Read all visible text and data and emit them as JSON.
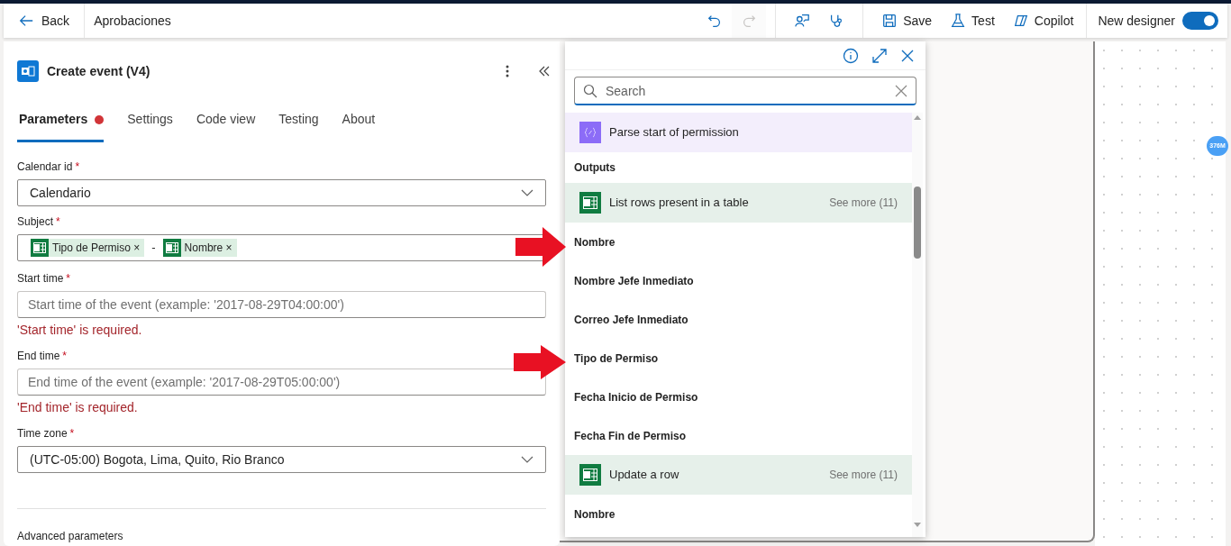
{
  "topbar": {
    "back": "Back",
    "flow_name": "Aprobaciones",
    "actions": [
      {
        "kind": "undo",
        "disabled": false
      },
      {
        "kind": "redo",
        "disabled": true
      },
      {
        "kind": "agent",
        "disabled": false
      },
      {
        "kind": "checker",
        "disabled": false
      },
      {
        "kind": "save",
        "label": "Save",
        "disabled": false
      },
      {
        "kind": "test",
        "label": "Test",
        "disabled": false
      },
      {
        "kind": "copilot",
        "label": "Copilot",
        "disabled": false
      }
    ],
    "toggle": {
      "label": "New designer",
      "on": true
    }
  },
  "panel": {
    "title": "Create event (V4)",
    "tabs": [
      {
        "label": "Parameters",
        "selected": true,
        "error": true
      },
      {
        "label": "Settings",
        "selected": false,
        "error": false
      },
      {
        "label": "Code view",
        "selected": false,
        "error": false
      },
      {
        "label": "Testing",
        "selected": false,
        "error": false
      },
      {
        "label": "About",
        "selected": false,
        "error": false
      }
    ],
    "fields": [
      {
        "kind": "dropdown",
        "label": "Calendar id",
        "required_mark": "*",
        "value": "Calendario"
      },
      {
        "kind": "tokens",
        "label": "Subject",
        "required_mark": "*",
        "tokens": [
          {
            "label": "Tipo de Permiso",
            "remove": "×"
          },
          {
            "label": "Nombre",
            "remove": "×"
          }
        ],
        "separator": "-"
      },
      {
        "kind": "text",
        "label": "Start time",
        "required_mark": "*",
        "placeholder": "Start time of the event (example: '2017-08-29T04:00:00')",
        "error": "'Start time' is required."
      },
      {
        "kind": "text",
        "label": "End time",
        "required_mark": "*",
        "placeholder": "End time of the event (example: '2017-08-29T05:00:00')",
        "error": "'End time' is required."
      },
      {
        "kind": "dropdown",
        "label": "Time zone",
        "required_mark": "*",
        "value": "(UTC-05:00) Bogota, Lima, Quito, Rio Branco"
      }
    ],
    "advanced": "Advanced parameters"
  },
  "picker": {
    "search": {
      "placeholder": "Search"
    },
    "items": [
      {
        "kind": "parse_action",
        "label": "Parse start of permission",
        "color": "#f3eefc"
      },
      {
        "kind": "section",
        "label": "Outputs"
      },
      {
        "kind": "excel_action",
        "label": "List rows present in a table",
        "color": "#e6f0ea",
        "see_more": "See more (11)"
      },
      {
        "kind": "token",
        "label": "Nombre"
      },
      {
        "kind": "token",
        "label": "Nombre Jefe Inmediato"
      },
      {
        "kind": "token",
        "label": "Correo Jefe Inmediato"
      },
      {
        "kind": "token",
        "label": "Tipo de Permiso"
      },
      {
        "kind": "token",
        "label": "Fecha Inicio de Permiso"
      },
      {
        "kind": "token",
        "label": "Fecha Fin de Permiso"
      },
      {
        "kind": "excel_action",
        "label": "Update a row",
        "color": "#e6f0ea",
        "see_more": "See more (11)"
      },
      {
        "kind": "token",
        "label": "Nombre"
      }
    ]
  },
  "badge": "376M"
}
